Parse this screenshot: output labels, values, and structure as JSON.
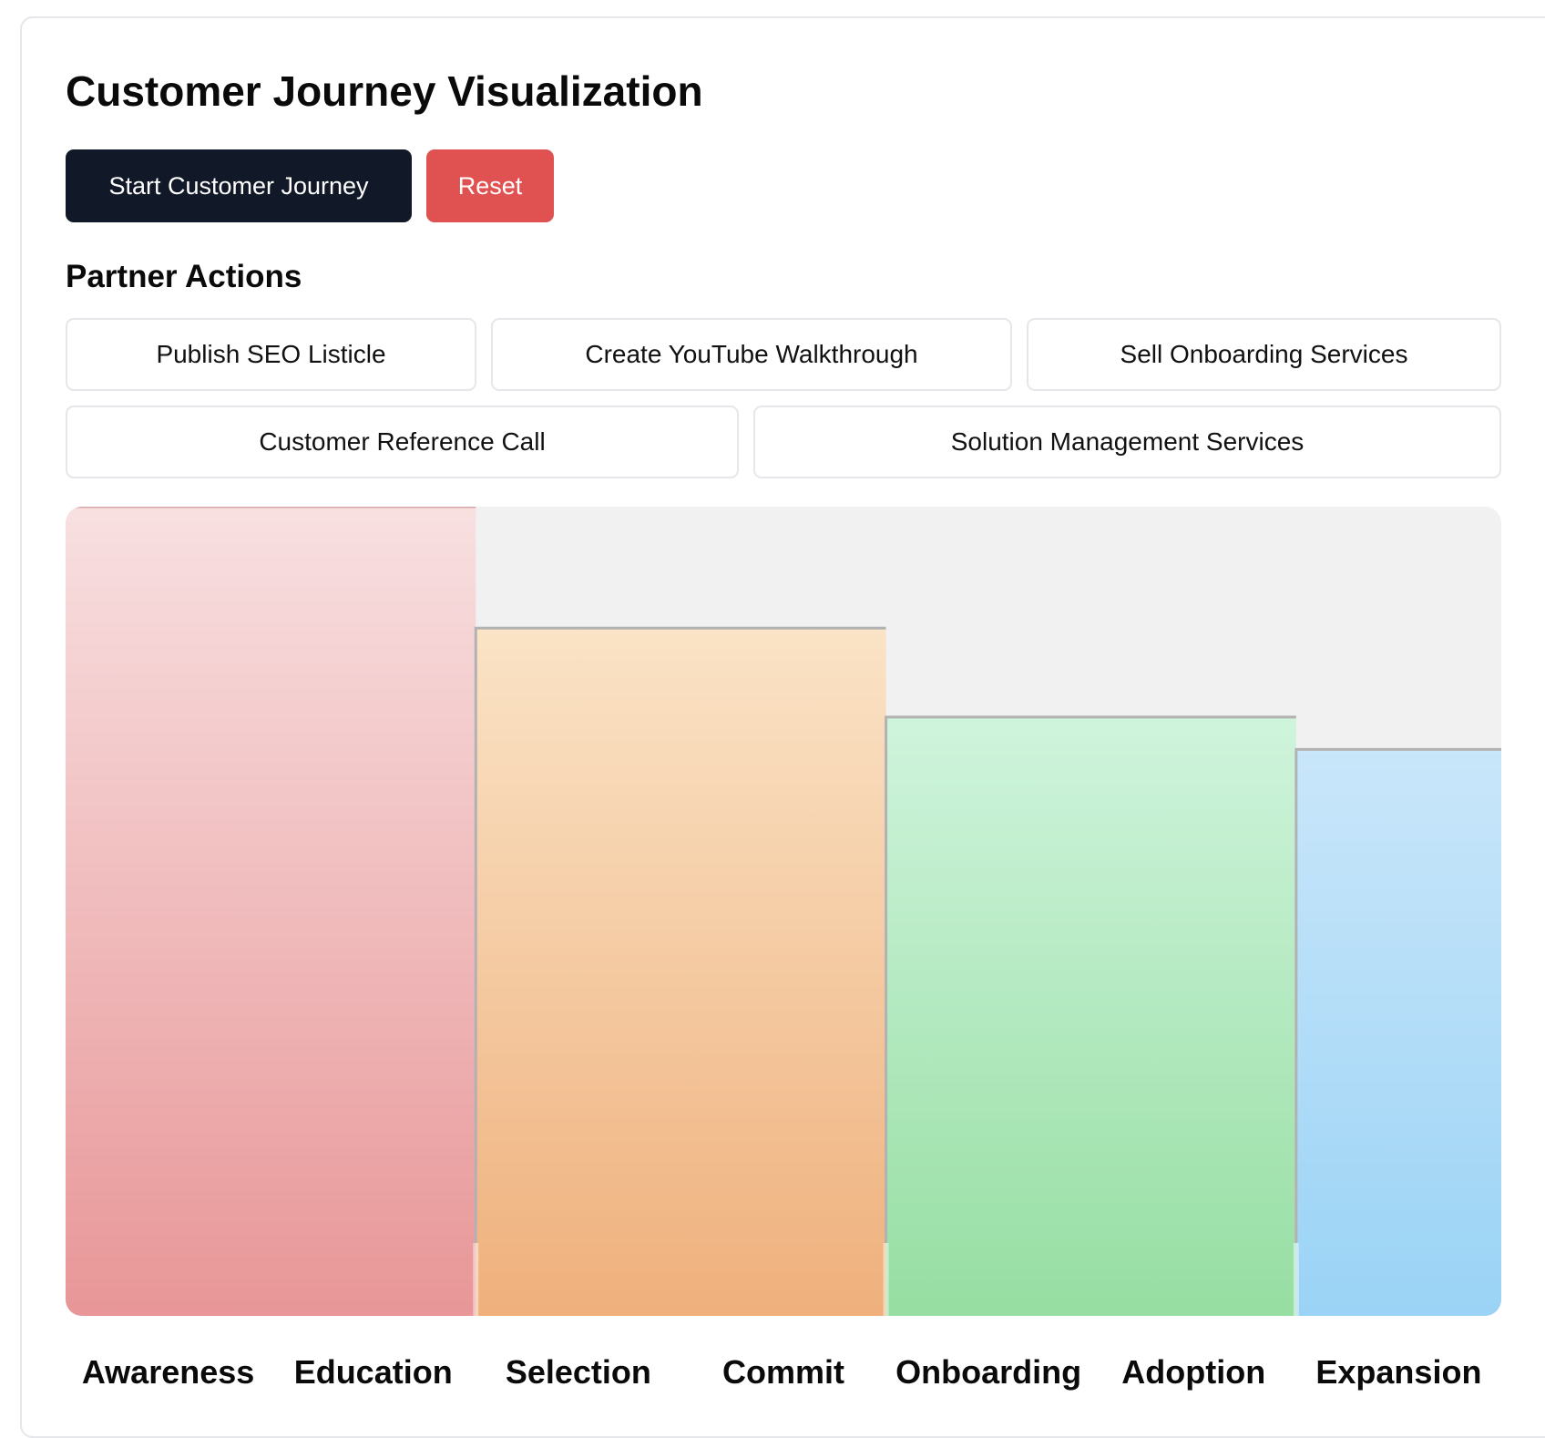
{
  "title": "Customer Journey Visualization",
  "controls": {
    "start_label": "Start Customer Journey",
    "reset_label": "Reset"
  },
  "partner_actions": {
    "heading": "Partner Actions",
    "items": [
      "Publish SEO Listicle",
      "Create YouTube Walkthrough",
      "Sell Onboarding Services",
      "Customer Reference Call",
      "Solution Management Services"
    ]
  },
  "colors": {
    "primary_button": "#111827",
    "reset_button": "#e05252",
    "chart_background": "#f1f1f1"
  },
  "chart_data": {
    "type": "area",
    "stages": [
      "Awareness",
      "Education",
      "Selection",
      "Commit",
      "Onboarding",
      "Adoption",
      "Expansion"
    ],
    "ylim": [
      0,
      100
    ],
    "segments": [
      {
        "from": 0,
        "to": 2,
        "value": 100,
        "color_top": "#f8e0e1",
        "color_bottom": "#e89697"
      },
      {
        "from": 2,
        "to": 4,
        "value": 85,
        "color_top": "#fae3c6",
        "color_bottom": "#efb07c"
      },
      {
        "from": 4,
        "to": 6,
        "value": 74,
        "color_top": "#cff4dc",
        "color_bottom": "#96dea2"
      },
      {
        "from": 6,
        "to": 7,
        "value": 70,
        "color_top": "#c9e6fa",
        "color_bottom": "#9ad3f5"
      }
    ]
  }
}
